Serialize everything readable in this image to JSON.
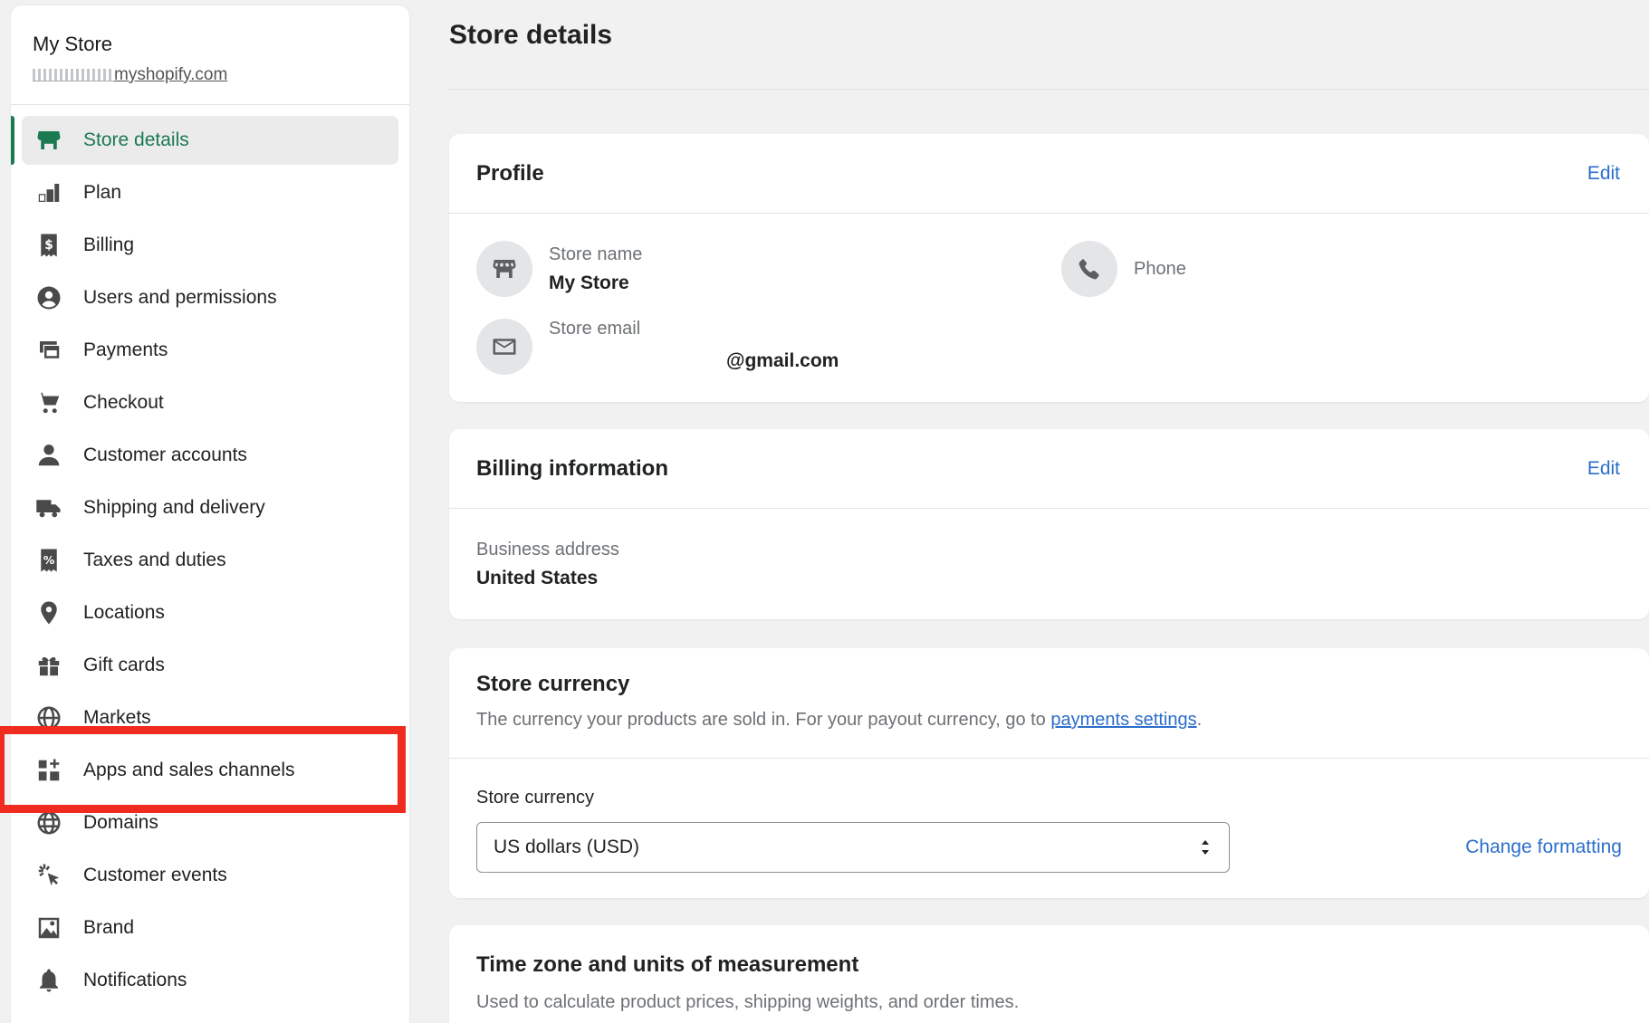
{
  "sidebar": {
    "store_name": "My Store",
    "store_domain": "myshopify.com",
    "items": [
      {
        "label": "Store details",
        "icon": "store-icon",
        "active": true
      },
      {
        "label": "Plan",
        "icon": "plan-icon"
      },
      {
        "label": "Billing",
        "icon": "billing-icon"
      },
      {
        "label": "Users and permissions",
        "icon": "user-circle-icon"
      },
      {
        "label": "Payments",
        "icon": "payments-icon"
      },
      {
        "label": "Checkout",
        "icon": "cart-icon"
      },
      {
        "label": "Customer accounts",
        "icon": "person-icon"
      },
      {
        "label": "Shipping and delivery",
        "icon": "truck-icon"
      },
      {
        "label": "Taxes and duties",
        "icon": "tax-receipt-icon"
      },
      {
        "label": "Locations",
        "icon": "location-pin-icon"
      },
      {
        "label": "Gift cards",
        "icon": "gift-icon"
      },
      {
        "label": "Markets",
        "icon": "globe-icon"
      },
      {
        "label": "Apps and sales channels",
        "icon": "apps-icon"
      },
      {
        "label": "Domains",
        "icon": "globe-domain-icon"
      },
      {
        "label": "Customer events",
        "icon": "cursor-click-icon"
      },
      {
        "label": "Brand",
        "icon": "brand-image-icon"
      },
      {
        "label": "Notifications",
        "icon": "bell-icon"
      }
    ]
  },
  "main": {
    "page_title": "Store details",
    "profile": {
      "title": "Profile",
      "edit_label": "Edit",
      "store_name_label": "Store name",
      "store_name_value": "My Store",
      "phone_label": "Phone",
      "store_email_label": "Store email",
      "store_email_value": "@gmail.com"
    },
    "billing": {
      "title": "Billing information",
      "edit_label": "Edit",
      "address_label": "Business address",
      "address_value": "United States"
    },
    "currency": {
      "title": "Store currency",
      "description_prefix": "The currency your products are sold in. For your payout currency, go to ",
      "description_link": "payments settings",
      "description_suffix": ".",
      "field_label": "Store currency",
      "selected": "US dollars (USD)",
      "change_formatting": "Change formatting"
    },
    "timezone": {
      "title": "Time zone and units of measurement",
      "description": "Used to calculate product prices, shipping weights, and order times."
    }
  },
  "colors": {
    "accent_green": "#1c7a52",
    "link_blue": "#2c6ecb",
    "highlight_red": "#f02b1f",
    "background": "#f1f1f2"
  }
}
